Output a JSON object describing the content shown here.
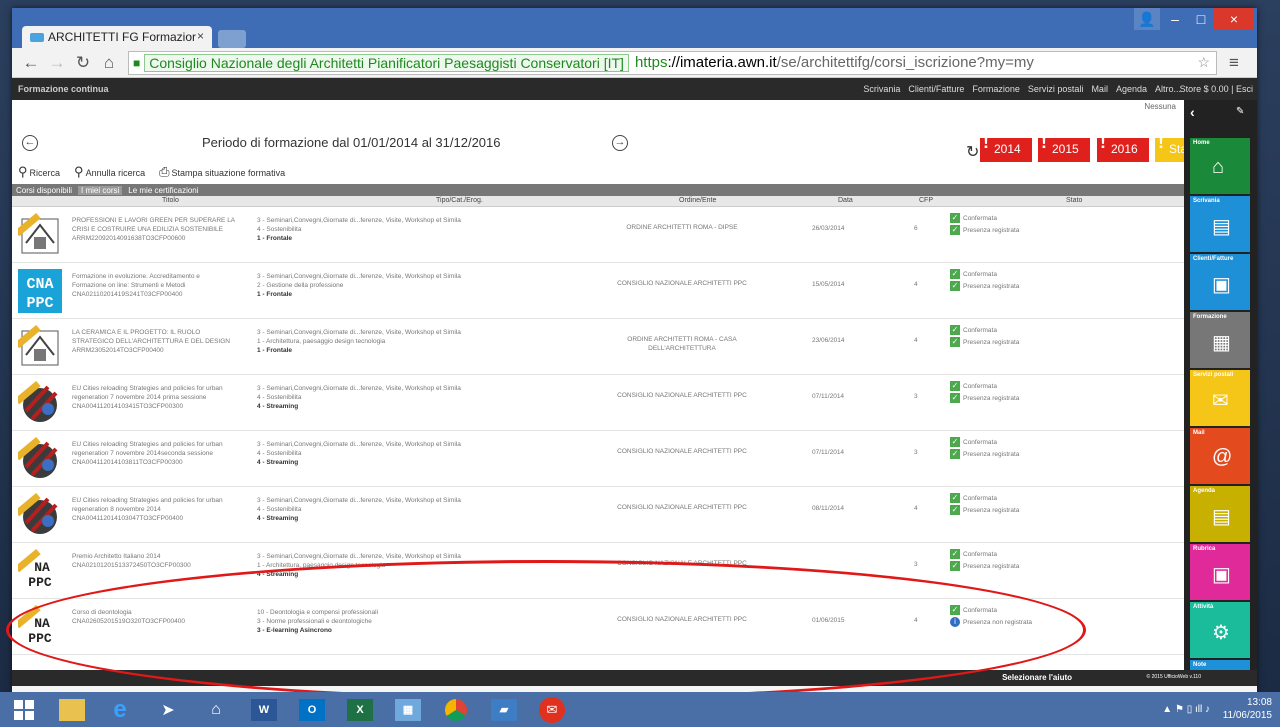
{
  "browser": {
    "tab_title": "ARCHITETTI FG Formazior",
    "tab_close": "×",
    "ev_label": "Consiglio Nazionale degli Architetti Pianificatori Paesaggisti Conservatori [IT]",
    "url_scheme": "https",
    "url_host": "://imateria.awn.it",
    "url_path": "/se/architettifg/corsi_iscrizione?my=my",
    "win_min": "–",
    "win_max": "□",
    "win_close": "×",
    "win_user": "👤"
  },
  "appbar": {
    "brand": "Formazione continua",
    "menu": [
      "Scrivania",
      "Clienti/Fatture",
      "Formazione",
      "Servizi postali",
      "Mail",
      "Agenda",
      "Altro..."
    ],
    "store": "Store $ 0.00 | Esci"
  },
  "period": {
    "title": "Periodo di formazione dal 01/01/2014 al 31/12/2016",
    "nessuna": "Nessuna",
    "years": [
      {
        "label": "2014",
        "color": "#e0201c"
      },
      {
        "label": "2015",
        "color": "#e0201c"
      },
      {
        "label": "2016",
        "color": "#e0201c"
      },
      {
        "label": "Status",
        "color": "#f5c518"
      }
    ]
  },
  "toolbar": {
    "search": "Ricerca",
    "cancel_search": "Annulla ricerca",
    "print": "Stampa situazione formativa"
  },
  "tabs": [
    "Corsi disponibili",
    "I miei corsi",
    "Le mie certificazioni"
  ],
  "columns": {
    "titolo": "Titolo",
    "tipo": "Tipo/Cat./Erog.",
    "ente": "Ordine/Ente",
    "data": "Data",
    "cfp": "CFP",
    "stato": "Stato"
  },
  "rows": [
    {
      "logo": "ordine-logo",
      "title": [
        "PROFESSIONI E LAVORI GREEN PER SUPERARE LA",
        "CRISI E COSTRUIRE UNA EDILIZIA SOSTENIBILE",
        "ARRM22092014091638TO3CFP00600"
      ],
      "tipo": [
        "3 - Seminari,Convegni,Giornate di...ferenze, Visite, Workshop et Simila",
        "4 - Sostenibilita"
      ],
      "erog": "1 - Frontale",
      "ente": [
        "ORDINE ARCHITETTI ROMA - DIPSE"
      ],
      "data": "26/03/2014",
      "cfp": "6",
      "stato": [
        "Confermata",
        "Presenza registrata"
      ]
    },
    {
      "logo": "cnappc-logo",
      "title": [
        "Formazione in evoluzione. Accreditamento e",
        "Formazione on line: Strumenti e Metodi",
        "CNA02110201419S241T03CFP00400"
      ],
      "tipo": [
        "3 - Seminari,Convegni,Giornate di...ferenze, Visite, Workshop et Simila",
        "2 - Gestione della professione"
      ],
      "erog": "1 - Frontale",
      "ente": [
        "CONSIGLIO NAZIONALE ARCHITETTI PPC"
      ],
      "data": "15/05/2014",
      "cfp": "4",
      "stato": [
        "Confermata",
        "Presenza registrata"
      ]
    },
    {
      "logo": "ordine-logo",
      "title": [
        "LA CERAMICA E IL PROGETTO: IL RUOLO",
        "STRATEGICO DELL'ARCHITETTURA E DEL DESIGN",
        "ARRM23052014TO3CFP00400"
      ],
      "tipo": [
        "3 - Seminari,Convegni,Giornate di...ferenze, Visite, Workshop et Simila",
        "1 - Architettura, paesaggio design tecnologia"
      ],
      "erog": "1 - Frontale",
      "ente": [
        "ORDINE ARCHITETTI ROMA - CASA",
        "DELL'ARCHITETTURA"
      ],
      "data": "23/06/2014",
      "cfp": "4",
      "stato": [
        "Confermata",
        "Presenza registrata"
      ]
    },
    {
      "logo": "eu-logo",
      "title": [
        "EU Cities reloading Strategies and policies for urban",
        "regeneration 7 novembre 2014 prima sessione",
        "CNA004112014103415TO3CFP00300"
      ],
      "tipo": [
        "3 - Seminari,Convegni,Giornate di...ferenze, Visite, Workshop et Simila",
        "4 - Sostenibilita"
      ],
      "erog": "4 - Streaming",
      "ente": [
        "CONSIGLIO NAZIONALE ARCHITETTI PPC"
      ],
      "data": "07/11/2014",
      "cfp": "3",
      "stato": [
        "Confermata",
        "Presenza registrata"
      ]
    },
    {
      "logo": "eu-logo",
      "title": [
        "EU Cities reloading Strategies and policies for urban",
        "regeneration 7 novembre 2014seconda sessione",
        "CNA004112014103811TO3CFP00300"
      ],
      "tipo": [
        "3 - Seminari,Convegni,Giornate di...ferenze, Visite, Workshop et Simila",
        "4 - Sostenibilita"
      ],
      "erog": "4 - Streaming",
      "ente": [
        "CONSIGLIO NAZIONALE ARCHITETTI PPC"
      ],
      "data": "07/11/2014",
      "cfp": "3",
      "stato": [
        "Confermata",
        "Presenza registrata"
      ]
    },
    {
      "logo": "eu-logo",
      "title": [
        "EU Cities reloading Strategies and policies for urban",
        "regeneration 8 novembre 2014",
        "CNA004112014103047TO3CFP00400"
      ],
      "tipo": [
        "3 - Seminari,Convegni,Giornate di...ferenze, Visite, Workshop et Simila",
        "4 - Sostenibilita"
      ],
      "erog": "4 - Streaming",
      "ente": [
        "CONSIGLIO NAZIONALE ARCHITETTI PPC"
      ],
      "data": "08/11/2014",
      "cfp": "4",
      "stato": [
        "Confermata",
        "Presenza registrata"
      ]
    },
    {
      "logo": "cnappc-small-logo",
      "title": [
        "Premio Architetto Italiano 2014",
        "CNA02101201513372450TO3CFP00300"
      ],
      "tipo": [
        "3 - Seminari,Convegni,Giornate di...ferenze, Visite, Workshop et Simila",
        "1 - Architettura, paesaggio design tecnologia"
      ],
      "erog": "4 - Streaming",
      "ente": [
        "CONSIGLIO NAZIONALE ARCHITETTI PPC"
      ],
      "data": "",
      "cfp": "3",
      "stato": [
        "Confermata",
        "Presenza registrata"
      ]
    },
    {
      "logo": "cnappc-small-logo",
      "title": [
        "Corso di deontologia",
        "CNA02605201519O320TO3CFP00400"
      ],
      "tipo": [
        "10 - Deontologia e compensi professionali",
        "3 - Norme professionali e deontologiche"
      ],
      "erog": "3 - E-learning Asincrono",
      "ente": [
        "CONSIGLIO NAZIONALE ARCHITETTI PPC"
      ],
      "data": "01/06/2015",
      "cfp": "4",
      "stato": [
        "Confermata",
        "Presenza non registrata"
      ]
    }
  ],
  "sidebar": [
    {
      "label": "Home",
      "color": "#1a8a3a",
      "icon": "home-icon",
      "glyph": "⌂"
    },
    {
      "label": "Scrivania",
      "color": "#1e90d8",
      "icon": "document-icon",
      "glyph": "▤"
    },
    {
      "label": "Clienti/Fatture",
      "color": "#1e90d8",
      "icon": "contact-icon",
      "glyph": "▣"
    },
    {
      "label": "Formazione",
      "color": "#777777",
      "icon": "cnappc-icon",
      "glyph": "▦"
    },
    {
      "label": "Servizi postali",
      "color": "#f5c518",
      "icon": "mail-icon",
      "glyph": "✉"
    },
    {
      "label": "Mail",
      "color": "#e34a1e",
      "icon": "at-icon",
      "glyph": "@"
    },
    {
      "label": "Agenda",
      "color": "#c8b000",
      "icon": "agenda-icon",
      "glyph": "▤"
    },
    {
      "label": "Rubrica",
      "color": "#e02a9a",
      "icon": "addressbook-icon",
      "glyph": "▣"
    },
    {
      "label": "Attività",
      "color": "#1abc9c",
      "icon": "gear-icon",
      "glyph": "⚙"
    },
    {
      "label": "Note",
      "color": "#1e90d8",
      "icon": "note-icon",
      "glyph": "▬"
    }
  ],
  "footer": {
    "help": "Selezionare l'aiuto",
    "copyright": "© 2015 UfficioWeb v.110"
  },
  "taskbar": {
    "time": "13:08",
    "date": "11/06/2015"
  }
}
